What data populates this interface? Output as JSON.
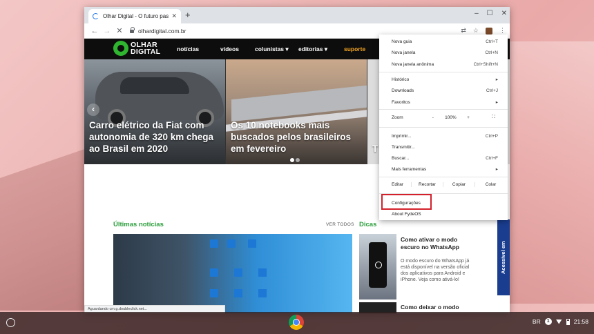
{
  "tab": {
    "title": "Olhar Digital - O futuro passa pri",
    "close": "✕",
    "new_tab": "+"
  },
  "window_controls": {
    "minimize": "–",
    "maximize": "☐",
    "close": "✕"
  },
  "toolbar": {
    "back": "←",
    "forward": "→",
    "stop": "✕",
    "url": "olhardigital.com.br",
    "translate": "⇄",
    "star": "☆",
    "menu": "⋮"
  },
  "site": {
    "logo_line1": "OLHAR",
    "logo_line2": "DIGITAL",
    "nav": [
      "notícias",
      "vídeos",
      "colunistas ▾",
      "editorias ▾",
      "suporte"
    ],
    "slides": [
      {
        "headline": "Carro elétrico da Fiat com autonomia de 320 km chega ao Brasil em 2020"
      },
      {
        "headline": "Os 10 notebooks mais buscados pelos brasileiros em fevereiro"
      },
      {
        "headline": "T d"
      }
    ],
    "prev_arrow": "‹",
    "latest_title": "Últimas notícias",
    "see_all": "VER TODOS",
    "tips_title": "Dicas",
    "side_article": {
      "headline": "Como ativar o modo escuro no WhatsApp",
      "text": "O modo escuro do WhatsApp já está disponível na versão oficial dos aplicativos para Android e iPhone. Veja como ativá-lo!"
    },
    "side_article2": {
      "headline": "Como deixar o modo"
    },
    "accessible_label": "Acessível em",
    "status": "Aguardando cm.g.doubleclick.net..."
  },
  "menu": {
    "items_top": [
      {
        "label": "Nova guia",
        "shortcut": "Ctrl+T"
      },
      {
        "label": "Nova janela",
        "shortcut": "Ctrl+N"
      },
      {
        "label": "Nova janela anônima",
        "shortcut": "Ctrl+Shift+N"
      }
    ],
    "items_mid": [
      {
        "label": "Histórico",
        "shortcut": "▸"
      },
      {
        "label": "Downloads",
        "shortcut": "Ctrl+J"
      },
      {
        "label": "Favoritos",
        "shortcut": "▸"
      }
    ],
    "zoom": {
      "label": "Zoom",
      "minus": "-",
      "value": "100%",
      "plus": "+",
      "fullscreen": "⛶"
    },
    "items_tools": [
      {
        "label": "Imprimir...",
        "shortcut": "Ctrl+P"
      },
      {
        "label": "Transmitir...",
        "shortcut": ""
      },
      {
        "label": "Buscar...",
        "shortcut": "Ctrl+F"
      },
      {
        "label": "Mais ferramentas",
        "shortcut": "▸"
      }
    ],
    "edit": {
      "label": "Editar",
      "cut": "Recortar",
      "copy": "Copiar",
      "paste": "Colar"
    },
    "settings": "Configurações",
    "about": "About FydeOS"
  },
  "shelf": {
    "keyboard": "BR",
    "notifications": "1",
    "time": "21:58"
  }
}
